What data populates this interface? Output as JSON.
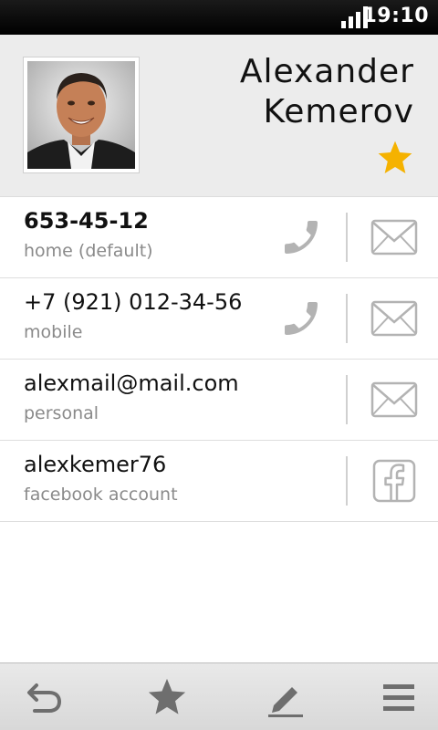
{
  "status_bar": {
    "time": "19:10",
    "signal_icon": "signal-bars-icon"
  },
  "contact": {
    "first_name": "Alexander",
    "last_name": "Kemerov",
    "favorite": true,
    "avatar_icon": "contact-photo",
    "star_color": "#f5b200"
  },
  "entries": [
    {
      "value": "653-45-12",
      "label": "home (default)",
      "actions": [
        "call-icon",
        "mail-icon"
      ]
    },
    {
      "value": "+7 (921) 012-34-56",
      "label": "mobile",
      "actions": [
        "call-icon",
        "mail-icon"
      ]
    },
    {
      "value": "alexmail@mail.com",
      "label": "personal",
      "actions": [
        "mail-icon"
      ]
    },
    {
      "value": "alexkemer76",
      "label": "facebook account",
      "actions": [
        "facebook-icon"
      ]
    }
  ],
  "bottom_bar": {
    "buttons": [
      "back-icon",
      "favorite-star-icon",
      "edit-pencil-icon",
      "menu-icon"
    ]
  }
}
